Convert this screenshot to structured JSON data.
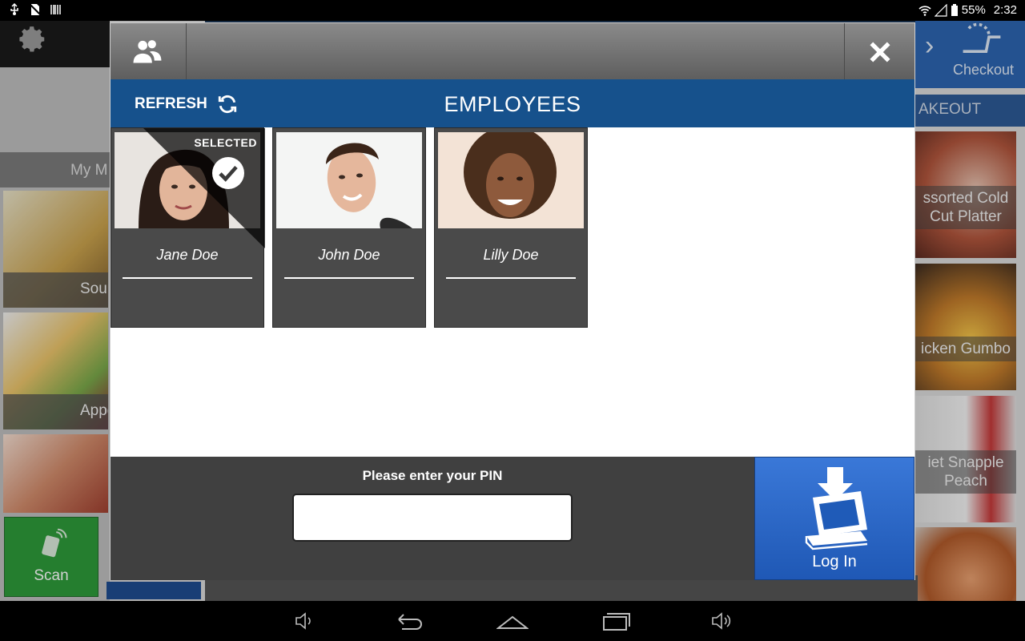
{
  "status_bar": {
    "battery": "55%",
    "time": "2:32"
  },
  "background": {
    "menu_label": "My M",
    "left_tiles": [
      "Sou",
      "Appeti",
      ""
    ],
    "scan_label": "Scan",
    "checkout_label": "Checkout",
    "takeout_label": "AKEOUT",
    "right_tiles": [
      "ssorted Cold\nCut Platter",
      "icken Gumbo",
      "iet Snapple\nPeach",
      ""
    ]
  },
  "modal": {
    "refresh_label": "REFRESH",
    "title": "EMPLOYEES",
    "selected_badge": "SELECTED",
    "employees": [
      {
        "name": "Jane Doe",
        "selected": true
      },
      {
        "name": "John Doe",
        "selected": false
      },
      {
        "name": "Lilly Doe",
        "selected": false
      }
    ],
    "pin_label": "Please enter your PIN",
    "pin_value": "",
    "login_label": "Log In"
  },
  "colors": {
    "header_blue": "#16518c",
    "login_blue": "#2a68c8",
    "card_gray": "#4a4a4a"
  }
}
